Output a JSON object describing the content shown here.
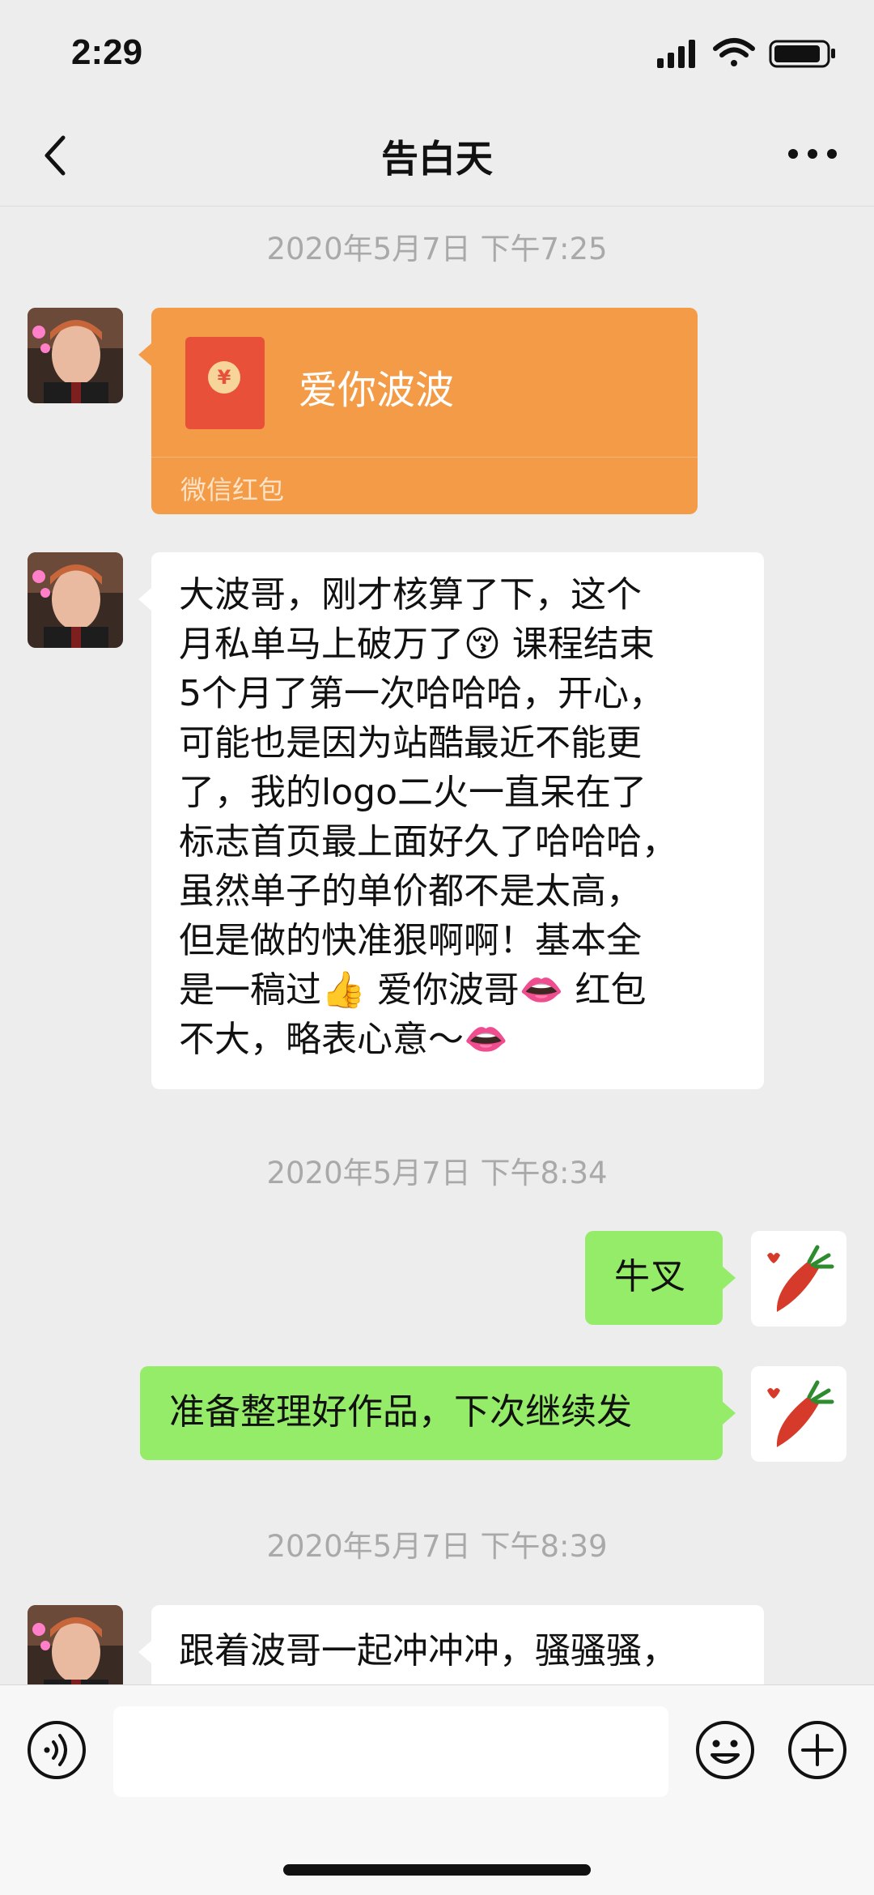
{
  "status_bar": {
    "time": "2:29"
  },
  "nav": {
    "title": "告白天"
  },
  "messages": {
    "ts1": "2020年5月7日 下午7:25",
    "red_packet": {
      "title": "爱你波波",
      "label": "微信红包"
    },
    "long_lines": [
      "大波哥，刚才核算了下，这个",
      "月私单马上破万了😚 课程结束",
      "5个月了第一次哈哈哈，开心，",
      "可能也是因为站酷最近不能更",
      "了，我的logo二火一直呆在了",
      "标志首页最上面好久了哈哈哈，",
      "虽然单子的单价都不是太高，",
      "但是做的快准狠啊啊！基本全",
      "是一稿过👍 爱你波哥👄 红包",
      "不大，略表心意～👄"
    ],
    "ts2": "2020年5月7日 下午8:34",
    "reply1": "牛叉",
    "reply2": "准备整理好作品，下次继续发",
    "ts3": "2020年5月7日 下午8:39",
    "last": "跟着波哥一起冲冲冲，骚骚骚，"
  },
  "icons": {
    "back": "chevron-left-icon",
    "more": "more-dots-icon",
    "voice": "voice-icon",
    "emoji": "smiley-icon",
    "plus": "plus-icon"
  },
  "colors": {
    "background": "#ededed",
    "bubble_green": "#95ec69",
    "bubble_white": "#ffffff",
    "red_packet": "#f39b46"
  }
}
